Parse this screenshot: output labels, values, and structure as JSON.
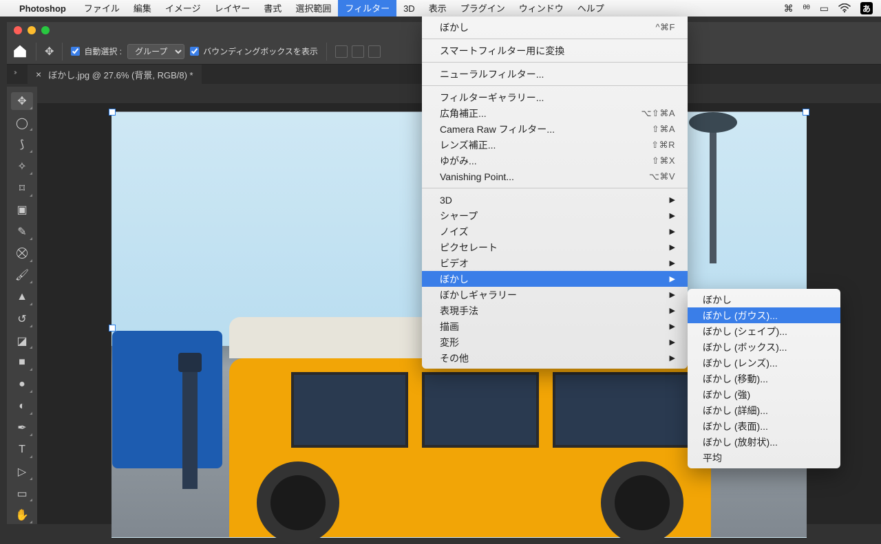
{
  "menubar": {
    "app_name": "Photoshop",
    "items": [
      "ファイル",
      "編集",
      "イメージ",
      "レイヤー",
      "書式",
      "選択範囲",
      "フィルター",
      "3D",
      "表示",
      "プラグイン",
      "ウィンドウ",
      "ヘルプ"
    ],
    "active_index": 6,
    "ime": "あ"
  },
  "optbar": {
    "auto_select_label": "自動選択 :",
    "group_select": "グループ",
    "bbox_label": "バウンディングボックスを表示"
  },
  "tab": {
    "title": "ぼかし.jpg @ 27.6% (背景, RGB/8) *"
  },
  "filter_menu": {
    "last": {
      "label": "ぼかし",
      "shortcut": "^⌘F"
    },
    "smart": "スマートフィルター用に変換",
    "neural": "ニューラルフィルター...",
    "gallery": "フィルターギャラリー...",
    "wideangle": {
      "label": "広角補正...",
      "shortcut": "⌥⇧⌘A"
    },
    "cameraraw": {
      "label": "Camera Raw フィルター...",
      "shortcut": "⇧⌘A"
    },
    "lens": {
      "label": "レンズ補正...",
      "shortcut": "⇧⌘R"
    },
    "liquify": {
      "label": "ゆがみ...",
      "shortcut": "⇧⌘X"
    },
    "vanishing": {
      "label": "Vanishing Point...",
      "shortcut": "⌥⌘V"
    },
    "subs": [
      "3D",
      "シャープ",
      "ノイズ",
      "ピクセレート",
      "ビデオ",
      "ぼかし",
      "ぼかしギャラリー",
      "表現手法",
      "描画",
      "変形",
      "その他"
    ],
    "sub_highlight_index": 5
  },
  "blur_submenu": {
    "items": [
      "ぼかし",
      "ぼかし (ガウス)...",
      "ぼかし (シェイプ)...",
      "ぼかし (ボックス)...",
      "ぼかし (レンズ)...",
      "ぼかし (移動)...",
      "ぼかし (強)",
      "ぼかし (詳細)...",
      "ぼかし (表面)...",
      "ぼかし (放射状)...",
      "平均"
    ],
    "highlight_index": 1
  }
}
